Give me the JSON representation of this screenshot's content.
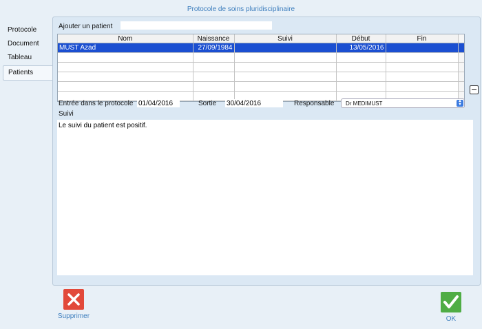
{
  "window": {
    "title": "Protocole de soins pluridisciplinaire"
  },
  "sidebar": {
    "items": [
      {
        "label": "Protocole"
      },
      {
        "label": "Document"
      },
      {
        "label": "Tableau"
      },
      {
        "label": "Patients"
      }
    ],
    "active": "Patients"
  },
  "add_patient": {
    "label": "Ajouter un patient",
    "value": ""
  },
  "table": {
    "columns": [
      "Nom",
      "Naissance",
      "Suivi",
      "Début",
      "Fin"
    ],
    "rows": [
      [
        "MUST Azad",
        "27/09/1984",
        "",
        "13/05/2016",
        ""
      ],
      [
        "",
        "",
        "",
        "",
        ""
      ],
      [
        "",
        "",
        "",
        "",
        ""
      ],
      [
        "",
        "",
        "",
        "",
        ""
      ],
      [
        "",
        "",
        "",
        "",
        ""
      ],
      [
        "",
        "",
        "",
        "",
        ""
      ]
    ]
  },
  "form": {
    "entry_label": "Entrée dans le protocole",
    "entry_value": "01/04/2016",
    "exit_label": "Sortie",
    "exit_value": "30/04/2016",
    "responsible_label": "Responsable",
    "responsible_value": "Dr MEDIMUST",
    "notes_label": "Suivi",
    "notes_value": "Le suivi du patient est positif."
  },
  "actions": {
    "delete_label": "Supprimer",
    "ok_label": "OK"
  },
  "colors": {
    "accent": "#3f7fbe",
    "selection": "#1b4fd1",
    "delete": "#e2493a",
    "ok": "#4fad45"
  }
}
